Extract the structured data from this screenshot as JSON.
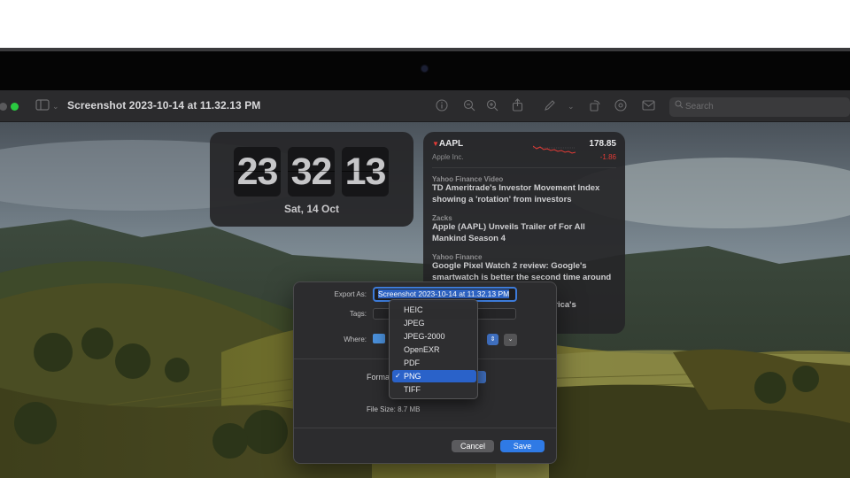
{
  "window": {
    "title": "Screenshot 2023-10-14 at 11.32.13 PM",
    "search_placeholder": "Search"
  },
  "clock_widget": {
    "hours": "23",
    "minutes": "32",
    "seconds": "13",
    "date": "Sat, 14 Oct"
  },
  "stocks_widget": {
    "symbol": "AAPL",
    "company": "Apple Inc.",
    "price": "178.85",
    "change": "-1.86",
    "news": [
      {
        "source": "Yahoo Finance Video",
        "headline": "TD Ameritrade's Investor Movement Index showing a 'rotation' from investors"
      },
      {
        "source": "Zacks",
        "headline": "Apple (AAPL) Unveils Trailer of For All Mankind Season 4"
      },
      {
        "source": "Yahoo Finance",
        "headline": "Google Pixel Watch 2 review: Google's smartwatch is better the second time around"
      },
      {
        "source": "",
        "headline": "erica's"
      }
    ]
  },
  "export_dialog": {
    "export_as_label": "Export As:",
    "export_as_value": "Screenshot 2023-10-14 at 11.32.13 PM",
    "tags_label": "Tags:",
    "where_label": "Where:",
    "format_label": "Forma",
    "file_size": "File Size:  8.7 MB",
    "cancel_label": "Cancel",
    "save_label": "Save"
  },
  "format_menu": {
    "options": [
      "HEIC",
      "JPEG",
      "JPEG-2000",
      "OpenEXR",
      "PDF",
      "PNG",
      "TIFF"
    ],
    "selected": "PNG"
  },
  "colors": {
    "accent": "#2f7ae5",
    "stock_down": "#e33b36",
    "traffic_light_green": "#2ac840"
  },
  "icons": [
    "sidebar-icon",
    "chevron-down-icon",
    "info-icon",
    "zoom-out-icon",
    "zoom-in-icon",
    "share-icon",
    "markup-pen-icon",
    "rotate-icon",
    "annotate-icon",
    "mail-icon",
    "search-icon",
    "folder-icon",
    "checkmark-icon"
  ]
}
